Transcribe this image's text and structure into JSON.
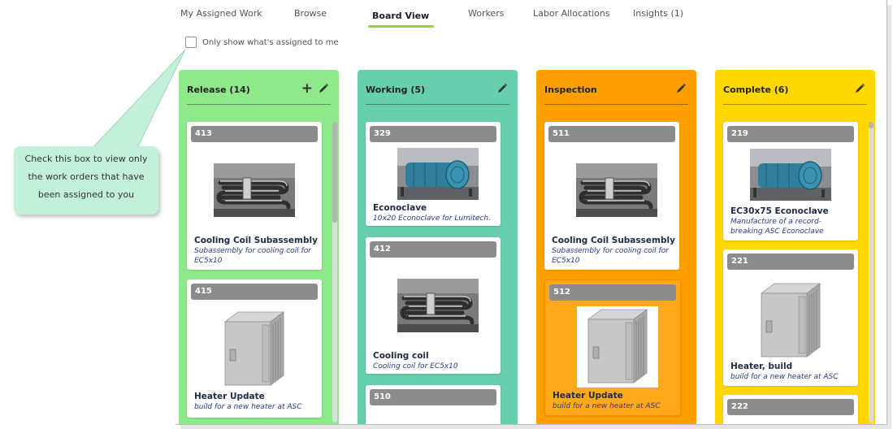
{
  "tabs": [
    {
      "label": "My Assigned Work"
    },
    {
      "label": "Browse"
    },
    {
      "label": "Board View"
    },
    {
      "label": "Workers"
    },
    {
      "label": "Labor Allocations"
    },
    {
      "label": "Insights (1)"
    }
  ],
  "active_tab": "Board View",
  "filter": {
    "label": "Only show what's assigned to me",
    "checked": false
  },
  "callout": {
    "line1": "Check this box to view only",
    "line2": "the work orders that have",
    "line3": "been assigned to you"
  },
  "columns": [
    {
      "title": "Release (14)",
      "color": "#8fe98b",
      "cards": [
        {
          "id": "413",
          "title": "Cooling Coil Subassembly",
          "sub": "Subassembly for cooling coil for EC5x10",
          "image": "coil-image"
        },
        {
          "id": "415",
          "title": "Heater Update",
          "sub": "build for a new heater at ASC",
          "image": "heater-image"
        }
      ]
    },
    {
      "title": "Working (5)",
      "color": "#67cfae",
      "cards": [
        {
          "id": "329",
          "title": "Econoclave",
          "sub": "10x20 Econoclave for Lumitech.",
          "image": "autoclave-image"
        },
        {
          "id": "412",
          "title": "Cooling coil",
          "sub": "Cooling coil for EC5x10",
          "image": "coil-image"
        },
        {
          "id": "510",
          "title": "",
          "sub": "",
          "image": ""
        }
      ]
    },
    {
      "title": "Inspection",
      "color": "#ff9f00",
      "cards": [
        {
          "id": "511",
          "title": "Cooling Coil Subassembly",
          "sub": "Subassembly for cooling coil for EC5x10",
          "image": "coil-image"
        },
        {
          "id": "512",
          "title": "Heater Update",
          "sub": "build for a new heater at ASC",
          "image": "heater-image"
        }
      ]
    },
    {
      "title": "Complete (6)",
      "color": "#ffd800",
      "cards": [
        {
          "id": "219",
          "title": "EC30x75 Econoclave",
          "sub": "Manufacture of a record-breaking ASC Econoclave",
          "image": "autoclave-image"
        },
        {
          "id": "221",
          "title": "Heater, build",
          "sub": "build for a new heater at ASC",
          "image": "heater-image"
        },
        {
          "id": "222",
          "title": "",
          "sub": "",
          "image": ""
        }
      ]
    }
  ],
  "icons": {
    "add": "plus-icon",
    "edit": "pencil-icon"
  }
}
